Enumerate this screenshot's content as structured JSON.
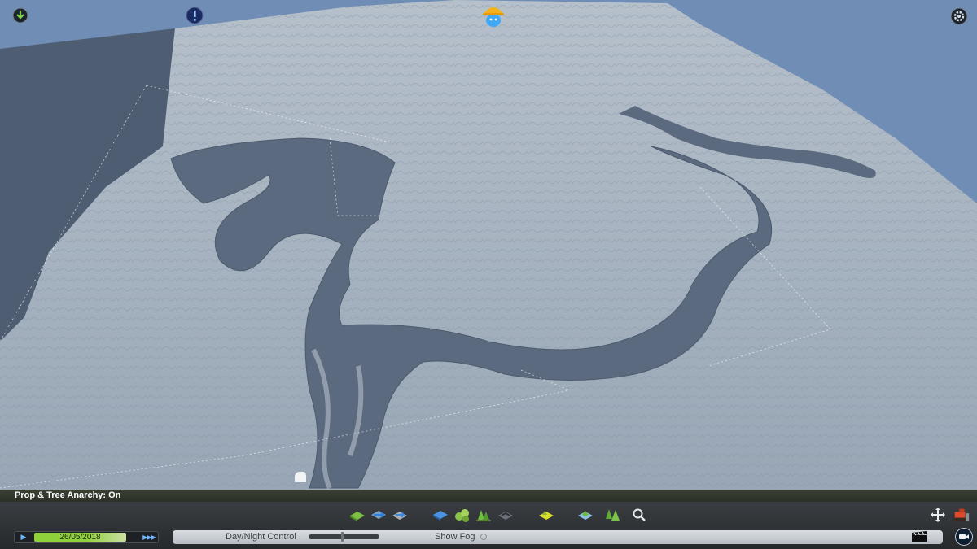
{
  "status": {
    "text": "Prop & Tree Anarchy: On"
  },
  "time_panel": {
    "date": "26/05/2018"
  },
  "environment": {
    "day_night_label": "Day/Night Control",
    "day_night_level": 0.48,
    "show_fog_label": "Show Fog",
    "show_fog": false
  },
  "top_icons": [
    "download-mod-icon",
    "info-alert-icon",
    "chirper-bird-icon",
    "options-gear-icon"
  ],
  "toolbar_icons": [
    "terrain-level-icon",
    "water-source-icon",
    "terrain-shift-icon",
    "water-tool-icon",
    "resources-icon",
    "trees-icon",
    "ditch-icon",
    "landscaping-icon",
    "map-grid-icon",
    "forest-icon",
    "search-icon",
    "move-icon",
    "bulldozer-icon"
  ],
  "colors": {
    "sky": "#6f8db5",
    "terrain": "#a2afbd",
    "water": "#58677b",
    "status_bar": "#34392f",
    "date_bar": "#8fd13a"
  }
}
